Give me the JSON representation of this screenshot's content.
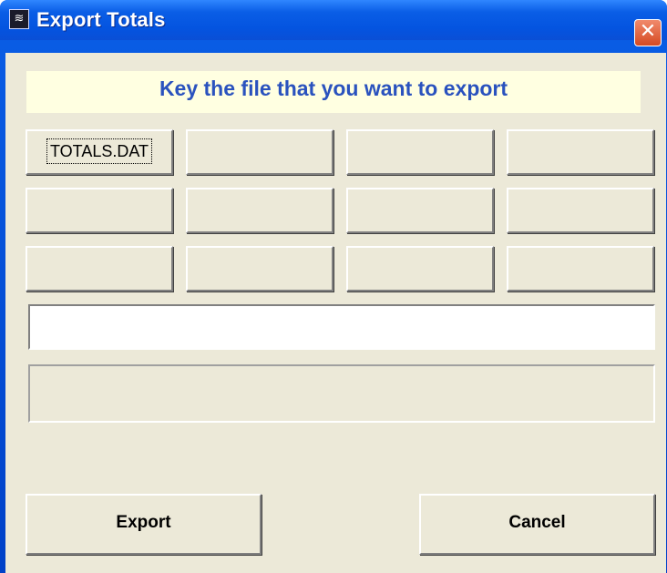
{
  "window": {
    "title": "Export Totals",
    "icon": "app-icon",
    "close_glyph": "✕"
  },
  "banner": {
    "text": "Key the file that you want to export"
  },
  "file_buttons": [
    {
      "label": "TOTALS.DAT",
      "focused": true
    },
    {
      "label": ""
    },
    {
      "label": ""
    },
    {
      "label": ""
    },
    {
      "label": ""
    },
    {
      "label": ""
    },
    {
      "label": ""
    },
    {
      "label": ""
    },
    {
      "label": ""
    },
    {
      "label": ""
    },
    {
      "label": ""
    },
    {
      "label": ""
    }
  ],
  "filename_input": {
    "value": "",
    "placeholder": ""
  },
  "status": {
    "text": ""
  },
  "actions": {
    "export_label": "Export",
    "cancel_label": "Cancel"
  },
  "colors": {
    "titlebar": "#0a5ee6",
    "client_background": "#ece9d8",
    "banner_background": "#ffffe1",
    "banner_text": "#2a52be",
    "close_button": "#d64a22"
  }
}
